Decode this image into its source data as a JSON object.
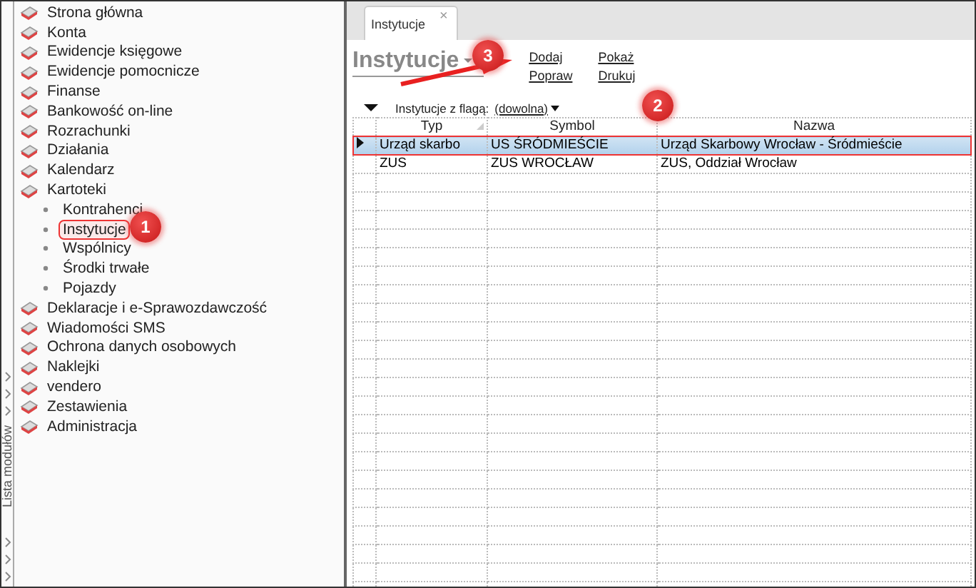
{
  "sidebar": {
    "side_label": "Lista modułów",
    "items": [
      {
        "label": "Strona główna",
        "kind": "module",
        "outlined": false
      },
      {
        "label": "Konta",
        "kind": "module",
        "outlined": false
      },
      {
        "label": "Ewidencje księgowe",
        "kind": "module",
        "outlined": false
      },
      {
        "label": "Ewidencje pomocnicze",
        "kind": "module",
        "outlined": false
      },
      {
        "label": "Finanse",
        "kind": "module",
        "outlined": false
      },
      {
        "label": "Bankowość on-line",
        "kind": "module",
        "outlined": false
      },
      {
        "label": "Rozrachunki",
        "kind": "module",
        "outlined": false
      },
      {
        "label": "Działania",
        "kind": "module",
        "outlined": false
      },
      {
        "label": "Kalendarz",
        "kind": "module",
        "outlined": false
      },
      {
        "label": "Kartoteki",
        "kind": "module",
        "outlined": false
      },
      {
        "label": "Kontrahenci",
        "kind": "sub",
        "outlined": false
      },
      {
        "label": "Instytucje",
        "kind": "sub",
        "outlined": true
      },
      {
        "label": "Wspólnicy",
        "kind": "sub",
        "outlined": false
      },
      {
        "label": "Środki trwałe",
        "kind": "sub",
        "outlined": false
      },
      {
        "label": "Pojazdy",
        "kind": "sub",
        "outlined": false
      },
      {
        "label": "Deklaracje i e-Sprawozdawczość",
        "kind": "module",
        "outlined": false
      },
      {
        "label": "Wiadomości SMS",
        "kind": "module",
        "outlined": false
      },
      {
        "label": "Ochrona danych osobowych",
        "kind": "module",
        "outlined": false
      },
      {
        "label": "Naklejki",
        "kind": "module",
        "outlined": false
      },
      {
        "label": "vendero",
        "kind": "module",
        "outlined": false
      },
      {
        "label": "Zestawienia",
        "kind": "module",
        "outlined": false
      },
      {
        "label": "Administracja",
        "kind": "module",
        "outlined": false
      }
    ]
  },
  "tab": {
    "label": "Instytucje",
    "close": "×"
  },
  "header": {
    "title": "Instytucje",
    "actions": [
      {
        "label": "Dodaj"
      },
      {
        "label": "Popraw"
      },
      {
        "label": "Pokaż"
      },
      {
        "label": "Drukuj"
      }
    ]
  },
  "filter": {
    "label": "Instytucje z flagą:",
    "value": "(dowolna)"
  },
  "table": {
    "columns": [
      "Typ",
      "Symbol",
      "Nazwa"
    ],
    "rows": [
      {
        "cells": [
          "Urząd skarbo",
          "US ŚRÓDMIEŚCIE",
          "Urząd Skarbowy Wrocław - Śródmieście"
        ],
        "selected": true,
        "outlined": true
      },
      {
        "cells": [
          "ZUS",
          "ZUS WROCŁAW",
          "ZUS, Oddział Wrocław"
        ],
        "selected": false,
        "outlined": false
      }
    ]
  },
  "callouts": [
    {
      "number": "1"
    },
    {
      "number": "2"
    },
    {
      "number": "3"
    }
  ]
}
